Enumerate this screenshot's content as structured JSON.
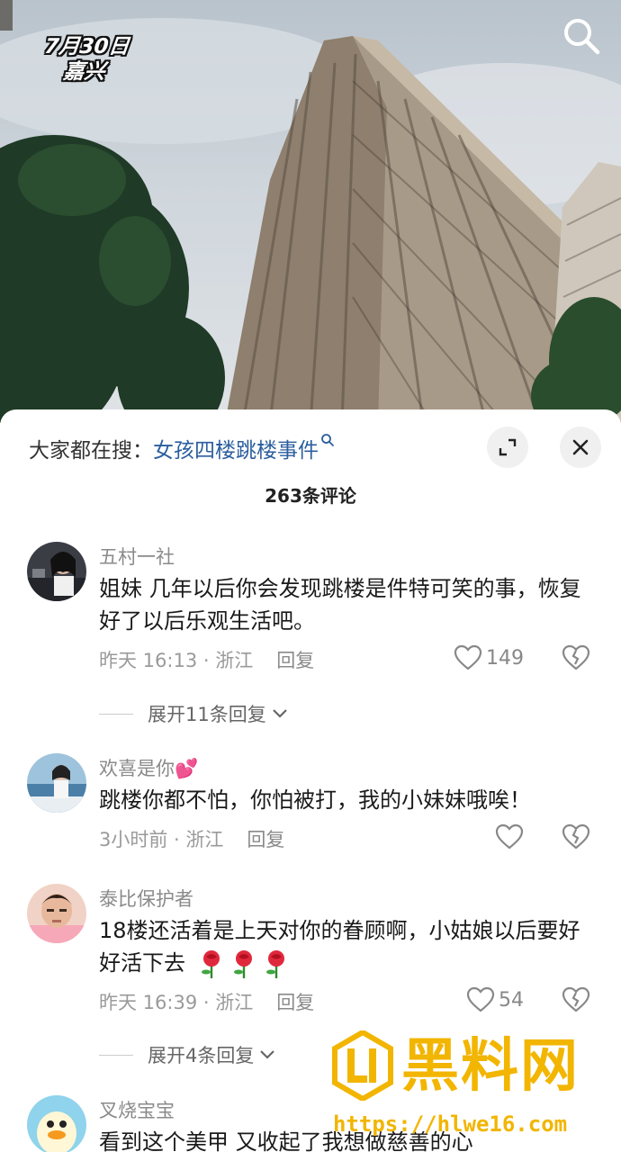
{
  "video": {
    "date": "7月30日",
    "place": "嘉兴"
  },
  "hot_search": {
    "prefix": "大家都在搜：",
    "keyword": "女孩四楼跳楼事件"
  },
  "comment_count": "263条评论",
  "comments": [
    {
      "name": "五村一社",
      "text": "姐妹 几年以后你会发现跳楼是件特可笑的事，恢复好了以后乐观生活吧。",
      "time": "昨天 16:13 · 浙江",
      "reply": "回复",
      "likes": "149",
      "expand": "展开11条回复"
    },
    {
      "name": "欢喜是你💕",
      "text": "跳楼你都不怕，你怕被打，我的小妹妹哦唉！",
      "time": "3小时前 · 浙江",
      "reply": "回复",
      "likes": ""
    },
    {
      "name": "泰比保护者",
      "text": "18楼还活着是上天对你的眷顾啊，小姑娘以后要好好活下去",
      "time": "昨天 16:39 · 浙江",
      "reply": "回复",
      "likes": "54",
      "expand": "展开4条回复"
    },
    {
      "name": "叉烧宝宝",
      "text": "看到这个美甲 又收起了我想做慈善的心"
    }
  ],
  "watermark": {
    "brand": "黑料网",
    "url": "https://hlwe16.com"
  },
  "colors": {
    "keyword": "#2b5e9e",
    "watermark": "#f2b500"
  }
}
